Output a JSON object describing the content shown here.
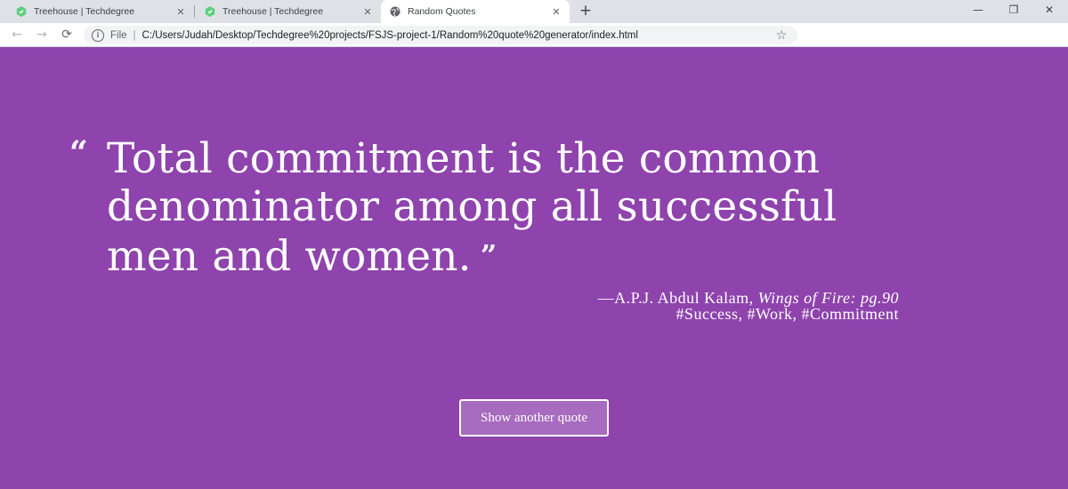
{
  "browser": {
    "tabs": [
      {
        "title": "Treehouse | Techdegree",
        "icon": "treehouse-icon",
        "active": false
      },
      {
        "title": "Treehouse | Techdegree",
        "icon": "treehouse-icon",
        "active": false
      },
      {
        "title": "Random Quotes",
        "icon": "globe-icon",
        "active": true
      }
    ],
    "new_tab_glyph": "+",
    "close_glyph": "✕",
    "window_controls": {
      "minimize": "—",
      "restore": "❐",
      "close": "✕"
    },
    "address": {
      "scheme_label": "File",
      "url": "C:/Users/Judah/Desktop/Techdegree%20projects/FSJS-project-1/Random%20quote%20generator/index.html"
    }
  },
  "page": {
    "background_color": "#8e43ad",
    "quote": "Total commitment is the common denominator among all successful men and women.",
    "open_quote_mark": "“",
    "close_quote_mark": "”",
    "source_prefix": "—A.P.J. Abdul Kalam, ",
    "citation": "Wings of Fire: pg.90",
    "tags": "#Success, #Work, #Commitment",
    "button_label": "Show another quote"
  }
}
